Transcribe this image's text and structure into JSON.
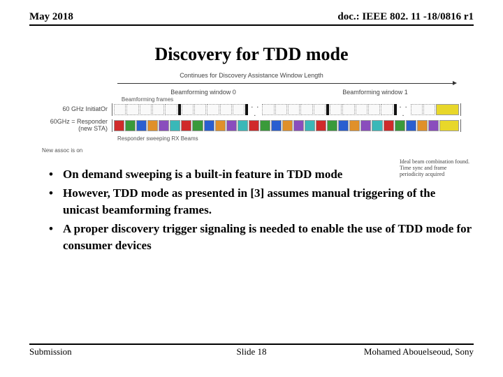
{
  "header": {
    "left": "May 2018",
    "right": "doc.: IEEE 802. 11 -18/0816 r1"
  },
  "title": "Discovery for TDD mode",
  "diagram": {
    "top_caption": "Continues for Discovery Assistance Window Length",
    "window0": "Beamforming window 0",
    "window1": "Beamforming window 1",
    "bf_frames": "Beamforming frames",
    "row1_label": "60 GHz InitiatOr",
    "row2_label": "60GHz = Responder (new STA)",
    "brace_label": "Responder sweeping RX Beams",
    "right_note": "Ideal beam combination found. Time sync and frame periodicity acquired",
    "new_assoc": "New assoc is on"
  },
  "bullets": {
    "b1": "On demand sweeping is a built-in feature in TDD mode",
    "b2": "However, TDD mode as presented in [3] assumes manual triggering of the unicast beamforming frames.",
    "b3": "A proper discovery trigger signaling is needed to enable the use of TDD mode for consumer devices"
  },
  "footer": {
    "left": "Submission",
    "center": "Slide 18",
    "right": "Mohamed Abouelseoud, Sony"
  }
}
